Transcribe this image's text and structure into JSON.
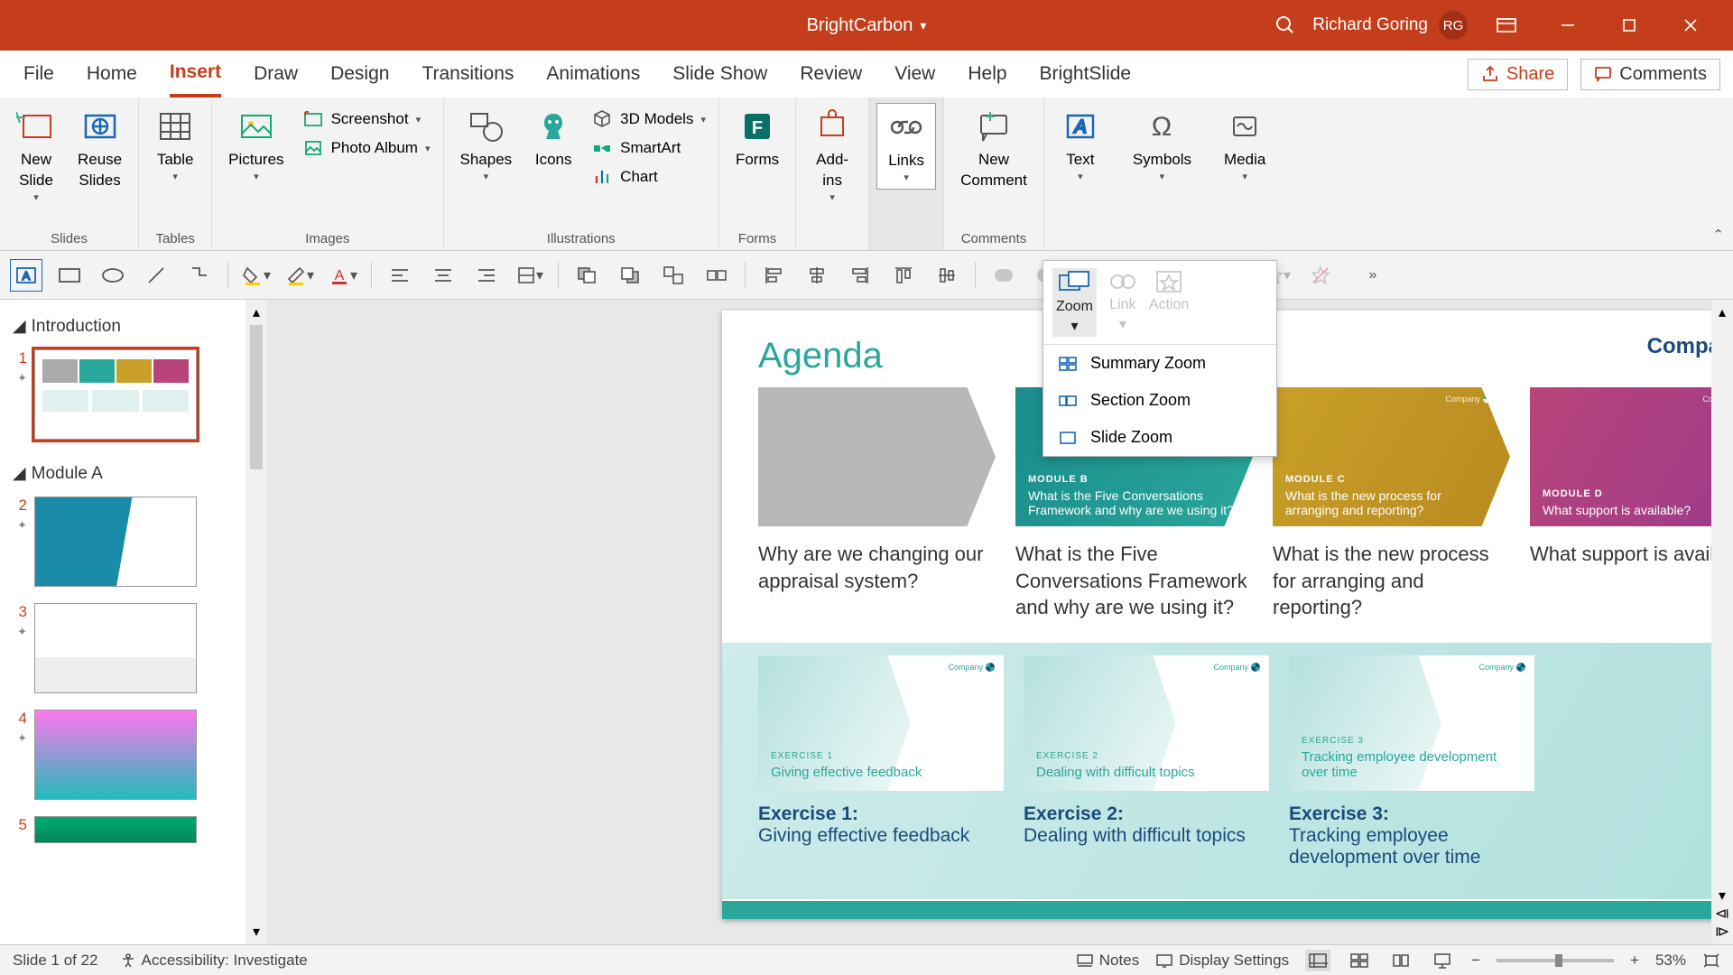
{
  "title": "BrightCarbon",
  "user": {
    "name": "Richard Goring",
    "initials": "RG"
  },
  "menu": {
    "tabs": [
      "File",
      "Home",
      "Insert",
      "Draw",
      "Design",
      "Transitions",
      "Animations",
      "Slide Show",
      "Review",
      "View",
      "Help",
      "BrightSlide"
    ],
    "active": "Insert",
    "share": "Share",
    "comments": "Comments"
  },
  "ribbon": {
    "slides": {
      "label": "Slides",
      "new_slide": "New\nSlide",
      "reuse_slides": "Reuse\nSlides"
    },
    "tables": {
      "label": "Tables",
      "table": "Table"
    },
    "images": {
      "label": "Images",
      "pictures": "Pictures",
      "screenshot": "Screenshot",
      "photo_album": "Photo Album"
    },
    "illustrations": {
      "label": "Illustrations",
      "shapes": "Shapes",
      "icons": "Icons",
      "models": "3D Models",
      "smartart": "SmartArt",
      "chart": "Chart"
    },
    "forms": {
      "label": "Forms",
      "forms": "Forms"
    },
    "addins": {
      "label": "",
      "addins": "Add-\nins"
    },
    "links": {
      "label": "",
      "links": "Links"
    },
    "comments": {
      "label": "Comments",
      "new_comment": "New\nComment"
    },
    "text": {
      "text": "Text"
    },
    "symbols": {
      "symbols": "Symbols"
    },
    "media": {
      "media": "Media"
    }
  },
  "zoom_popup": {
    "zoom": "Zoom",
    "link": "Link",
    "action": "Action",
    "items": [
      "Summary Zoom",
      "Section Zoom",
      "Slide Zoom"
    ]
  },
  "sections": {
    "intro": "Introduction",
    "moda": "Module A"
  },
  "thumbs": [
    "1",
    "2",
    "3",
    "4",
    "5"
  ],
  "slide": {
    "title": "Agenda",
    "company": "Company",
    "cards": [
      {
        "mod": "",
        "img_text": "",
        "text": "Why are we changing our appraisal system?"
      },
      {
        "mod": "MODULE B",
        "img_text": "What is the Five Conversations Framework and why are we using it?",
        "text": "What is the Five Conversations Framework and why are we using it?"
      },
      {
        "mod": "MODULE C",
        "img_text": "What is the new process for arranging and reporting?",
        "text": "What is the new process for arranging and reporting?"
      },
      {
        "mod": "MODULE D",
        "img_text": "What support is available?",
        "text": "What support is available?"
      }
    ],
    "exercises": [
      {
        "lab": "EXERCISE 1",
        "img_text": "Giving effective feedback",
        "title": "Exercise 1:",
        "text": "Giving effective feedback"
      },
      {
        "lab": "EXERCISE 2",
        "img_text": "Dealing with difficult topics",
        "title": "Exercise 2:",
        "text": "Dealing with difficult topics"
      },
      {
        "lab": "EXERCISE 3",
        "img_text": "Tracking employee development over time",
        "title": "Exercise 3:",
        "text": "Tracking employee development over time"
      }
    ]
  },
  "status": {
    "slide": "Slide 1 of 22",
    "a11y": "Accessibility: Investigate",
    "notes": "Notes",
    "display": "Display Settings",
    "zoom": "53%"
  }
}
